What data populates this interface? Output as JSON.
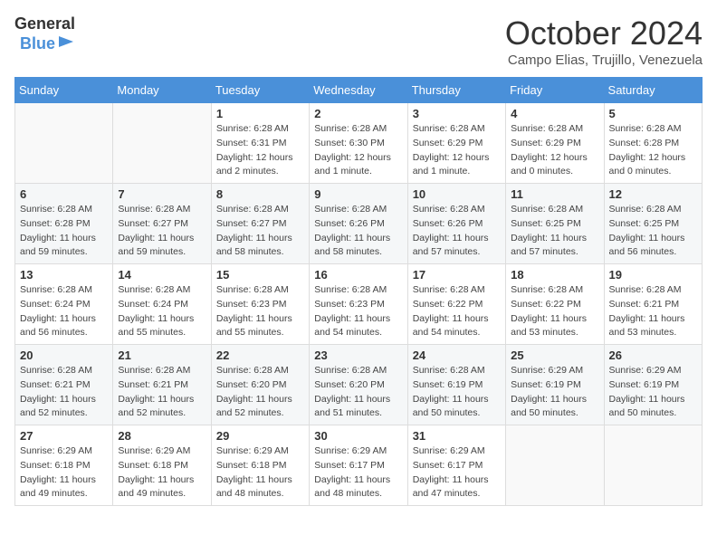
{
  "header": {
    "logo_general": "General",
    "logo_blue": "Blue",
    "month_title": "October 2024",
    "location": "Campo Elias, Trujillo, Venezuela"
  },
  "calendar": {
    "days_of_week": [
      "Sunday",
      "Monday",
      "Tuesday",
      "Wednesday",
      "Thursday",
      "Friday",
      "Saturday"
    ],
    "weeks": [
      [
        {
          "day": "",
          "info": ""
        },
        {
          "day": "",
          "info": ""
        },
        {
          "day": "1",
          "info": "Sunrise: 6:28 AM\nSunset: 6:31 PM\nDaylight: 12 hours and 2 minutes."
        },
        {
          "day": "2",
          "info": "Sunrise: 6:28 AM\nSunset: 6:30 PM\nDaylight: 12 hours and 1 minute."
        },
        {
          "day": "3",
          "info": "Sunrise: 6:28 AM\nSunset: 6:29 PM\nDaylight: 12 hours and 1 minute."
        },
        {
          "day": "4",
          "info": "Sunrise: 6:28 AM\nSunset: 6:29 PM\nDaylight: 12 hours and 0 minutes."
        },
        {
          "day": "5",
          "info": "Sunrise: 6:28 AM\nSunset: 6:28 PM\nDaylight: 12 hours and 0 minutes."
        }
      ],
      [
        {
          "day": "6",
          "info": "Sunrise: 6:28 AM\nSunset: 6:28 PM\nDaylight: 11 hours and 59 minutes."
        },
        {
          "day": "7",
          "info": "Sunrise: 6:28 AM\nSunset: 6:27 PM\nDaylight: 11 hours and 59 minutes."
        },
        {
          "day": "8",
          "info": "Sunrise: 6:28 AM\nSunset: 6:27 PM\nDaylight: 11 hours and 58 minutes."
        },
        {
          "day": "9",
          "info": "Sunrise: 6:28 AM\nSunset: 6:26 PM\nDaylight: 11 hours and 58 minutes."
        },
        {
          "day": "10",
          "info": "Sunrise: 6:28 AM\nSunset: 6:26 PM\nDaylight: 11 hours and 57 minutes."
        },
        {
          "day": "11",
          "info": "Sunrise: 6:28 AM\nSunset: 6:25 PM\nDaylight: 11 hours and 57 minutes."
        },
        {
          "day": "12",
          "info": "Sunrise: 6:28 AM\nSunset: 6:25 PM\nDaylight: 11 hours and 56 minutes."
        }
      ],
      [
        {
          "day": "13",
          "info": "Sunrise: 6:28 AM\nSunset: 6:24 PM\nDaylight: 11 hours and 56 minutes."
        },
        {
          "day": "14",
          "info": "Sunrise: 6:28 AM\nSunset: 6:24 PM\nDaylight: 11 hours and 55 minutes."
        },
        {
          "day": "15",
          "info": "Sunrise: 6:28 AM\nSunset: 6:23 PM\nDaylight: 11 hours and 55 minutes."
        },
        {
          "day": "16",
          "info": "Sunrise: 6:28 AM\nSunset: 6:23 PM\nDaylight: 11 hours and 54 minutes."
        },
        {
          "day": "17",
          "info": "Sunrise: 6:28 AM\nSunset: 6:22 PM\nDaylight: 11 hours and 54 minutes."
        },
        {
          "day": "18",
          "info": "Sunrise: 6:28 AM\nSunset: 6:22 PM\nDaylight: 11 hours and 53 minutes."
        },
        {
          "day": "19",
          "info": "Sunrise: 6:28 AM\nSunset: 6:21 PM\nDaylight: 11 hours and 53 minutes."
        }
      ],
      [
        {
          "day": "20",
          "info": "Sunrise: 6:28 AM\nSunset: 6:21 PM\nDaylight: 11 hours and 52 minutes."
        },
        {
          "day": "21",
          "info": "Sunrise: 6:28 AM\nSunset: 6:21 PM\nDaylight: 11 hours and 52 minutes."
        },
        {
          "day": "22",
          "info": "Sunrise: 6:28 AM\nSunset: 6:20 PM\nDaylight: 11 hours and 52 minutes."
        },
        {
          "day": "23",
          "info": "Sunrise: 6:28 AM\nSunset: 6:20 PM\nDaylight: 11 hours and 51 minutes."
        },
        {
          "day": "24",
          "info": "Sunrise: 6:28 AM\nSunset: 6:19 PM\nDaylight: 11 hours and 50 minutes."
        },
        {
          "day": "25",
          "info": "Sunrise: 6:29 AM\nSunset: 6:19 PM\nDaylight: 11 hours and 50 minutes."
        },
        {
          "day": "26",
          "info": "Sunrise: 6:29 AM\nSunset: 6:19 PM\nDaylight: 11 hours and 50 minutes."
        }
      ],
      [
        {
          "day": "27",
          "info": "Sunrise: 6:29 AM\nSunset: 6:18 PM\nDaylight: 11 hours and 49 minutes."
        },
        {
          "day": "28",
          "info": "Sunrise: 6:29 AM\nSunset: 6:18 PM\nDaylight: 11 hours and 49 minutes."
        },
        {
          "day": "29",
          "info": "Sunrise: 6:29 AM\nSunset: 6:18 PM\nDaylight: 11 hours and 48 minutes."
        },
        {
          "day": "30",
          "info": "Sunrise: 6:29 AM\nSunset: 6:17 PM\nDaylight: 11 hours and 48 minutes."
        },
        {
          "day": "31",
          "info": "Sunrise: 6:29 AM\nSunset: 6:17 PM\nDaylight: 11 hours and 47 minutes."
        },
        {
          "day": "",
          "info": ""
        },
        {
          "day": "",
          "info": ""
        }
      ]
    ]
  }
}
